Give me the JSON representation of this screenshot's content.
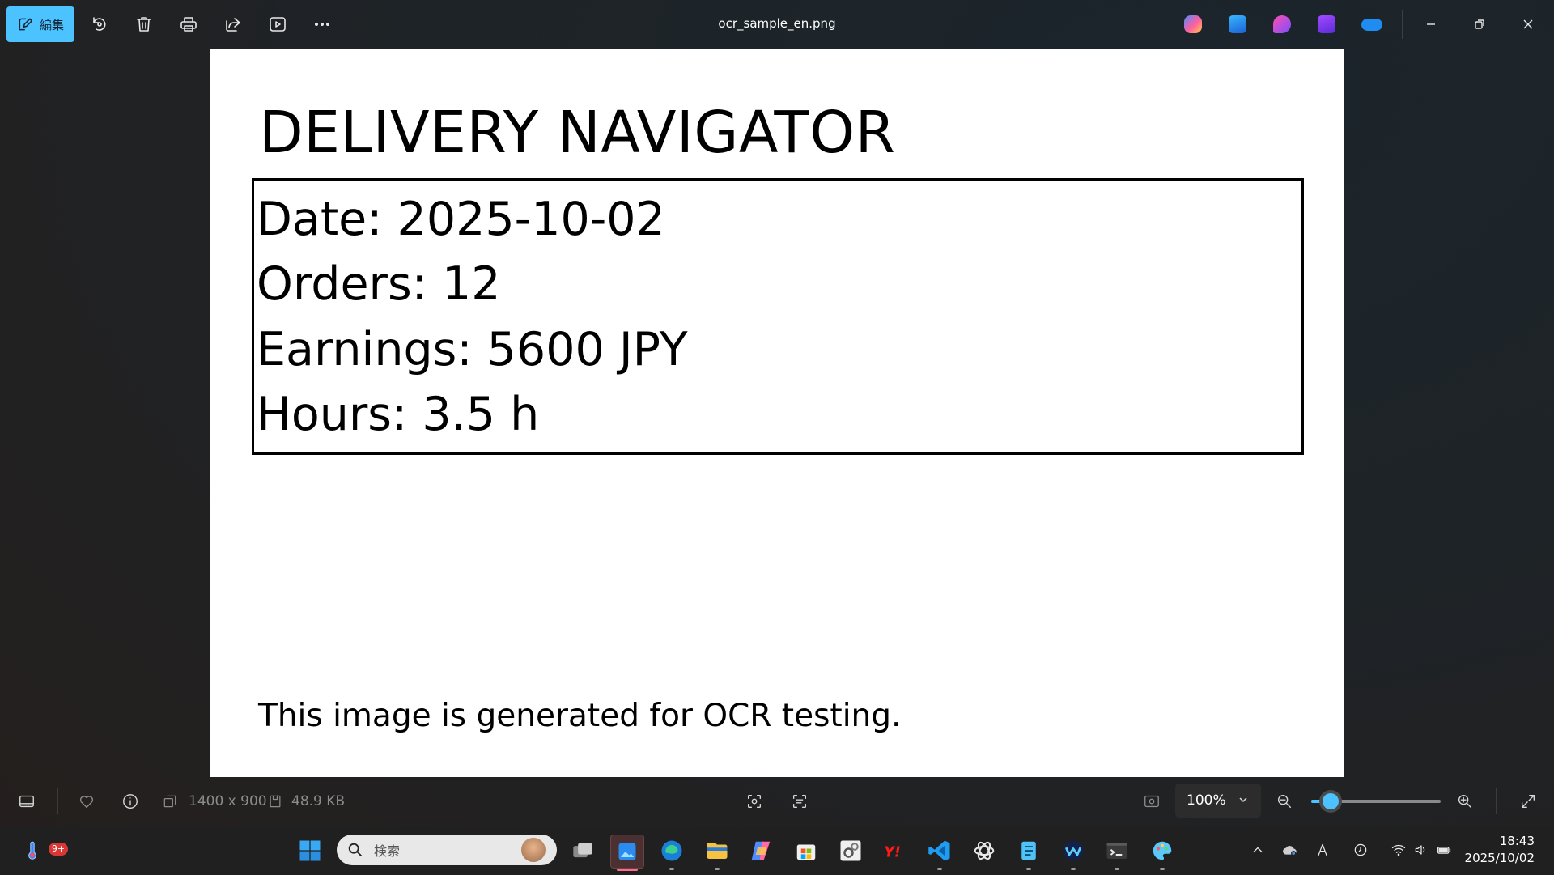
{
  "window": {
    "title": "ocr_sample_en.png",
    "edit_label": "編集"
  },
  "document": {
    "title": "DELIVERY NAVIGATOR",
    "lines": [
      "Date: 2025-10-02",
      "Orders: 12",
      "Earnings: 5600 JPY",
      "Hours: 3.5 h"
    ],
    "footer": "This image is generated for OCR testing."
  },
  "status": {
    "dimensions": "1400 x 900",
    "file_size": "48.9 KB",
    "zoom": "100%",
    "zoom_slider_fraction": 0.15
  },
  "taskbar": {
    "search_placeholder": "検索",
    "weather_badge": "9+",
    "time": "18:43",
    "date": "2025/10/02"
  },
  "colors": {
    "accent": "#4cc2ff",
    "background": "#1e2327",
    "taskbar": "#202020"
  }
}
